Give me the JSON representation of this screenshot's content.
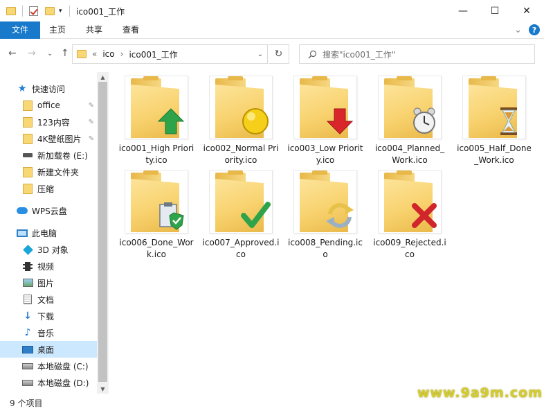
{
  "window": {
    "title": "ico001_工作",
    "controls": {
      "minimize": "—",
      "maximize": "☐",
      "close": "✕"
    }
  },
  "ribbon": {
    "tabs": [
      {
        "label": "文件"
      },
      {
        "label": "主页"
      },
      {
        "label": "共享"
      },
      {
        "label": "查看"
      }
    ],
    "collapse_glyph": "⌄",
    "help_glyph": "?"
  },
  "navigation": {
    "back_glyph": "←",
    "forward_glyph": "→",
    "recent_glyph": "⌄",
    "up_glyph": "↑",
    "refresh_glyph": "↻"
  },
  "address": {
    "overflow": "«",
    "crumbs": [
      "ico",
      "ico001_工作"
    ],
    "separator": "›"
  },
  "search": {
    "placeholder": "搜索\"ico001_工作\"",
    "icon": "search-icon"
  },
  "sidebar": {
    "items": [
      {
        "label": "快速访问",
        "icon": "star-icon"
      },
      {
        "label": "office",
        "icon": "folder-icon",
        "pinned": true
      },
      {
        "label": "123内容",
        "icon": "folder-icon",
        "pinned": true
      },
      {
        "label": "4K壁纸图片",
        "icon": "folder-icon",
        "pinned": true
      },
      {
        "label": "新加载卷 (E:)",
        "icon": "drive-icon"
      },
      {
        "label": "新建文件夹",
        "icon": "folder-icon"
      },
      {
        "label": "压缩",
        "icon": "folder-icon"
      },
      {
        "label": "WPS云盘",
        "icon": "cloud-icon"
      },
      {
        "label": "此电脑",
        "icon": "computer-icon"
      },
      {
        "label": "3D 对象",
        "icon": "3d-objects-icon"
      },
      {
        "label": "视频",
        "icon": "video-icon"
      },
      {
        "label": "图片",
        "icon": "pictures-icon"
      },
      {
        "label": "文档",
        "icon": "documents-icon"
      },
      {
        "label": "下载",
        "icon": "download-icon"
      },
      {
        "label": "音乐",
        "icon": "music-icon"
      },
      {
        "label": "桌面",
        "icon": "desktop-icon",
        "selected": true
      },
      {
        "label": "本地磁盘 (C:)",
        "icon": "hard-disk-icon"
      },
      {
        "label": "本地磁盘 (D:)",
        "icon": "hard-disk-icon"
      }
    ],
    "pin_glyph": "📌"
  },
  "files": [
    {
      "name": "ico001_High Priority.ico",
      "overlay": "green-up-arrow-icon"
    },
    {
      "name": "ico002_Normal Priority.ico",
      "overlay": "yellow-circle-icon"
    },
    {
      "name": "ico003_Low Priority.ico",
      "overlay": "red-down-arrow-icon"
    },
    {
      "name": "ico004_Planned_Work.ico",
      "overlay": "alarm-clock-icon"
    },
    {
      "name": "ico005_Half_Done_Work.ico",
      "overlay": "hourglass-icon"
    },
    {
      "name": "ico006_Done_Work.ico",
      "overlay": "clipboard-check-icon"
    },
    {
      "name": "ico007_Approved.ico",
      "overlay": "green-check-icon"
    },
    {
      "name": "ico008_Pending.ico",
      "overlay": "refresh-arrows-icon"
    },
    {
      "name": "ico009_Rejected.ico",
      "overlay": "red-x-icon"
    }
  ],
  "status": {
    "item_count": "9 个项目"
  },
  "watermark": "www.9a9m.com",
  "colors": {
    "accent": "#1979ca",
    "selected_bg": "#cce8ff",
    "folder": "#f8d775",
    "watermark": "#d4cc2d"
  }
}
